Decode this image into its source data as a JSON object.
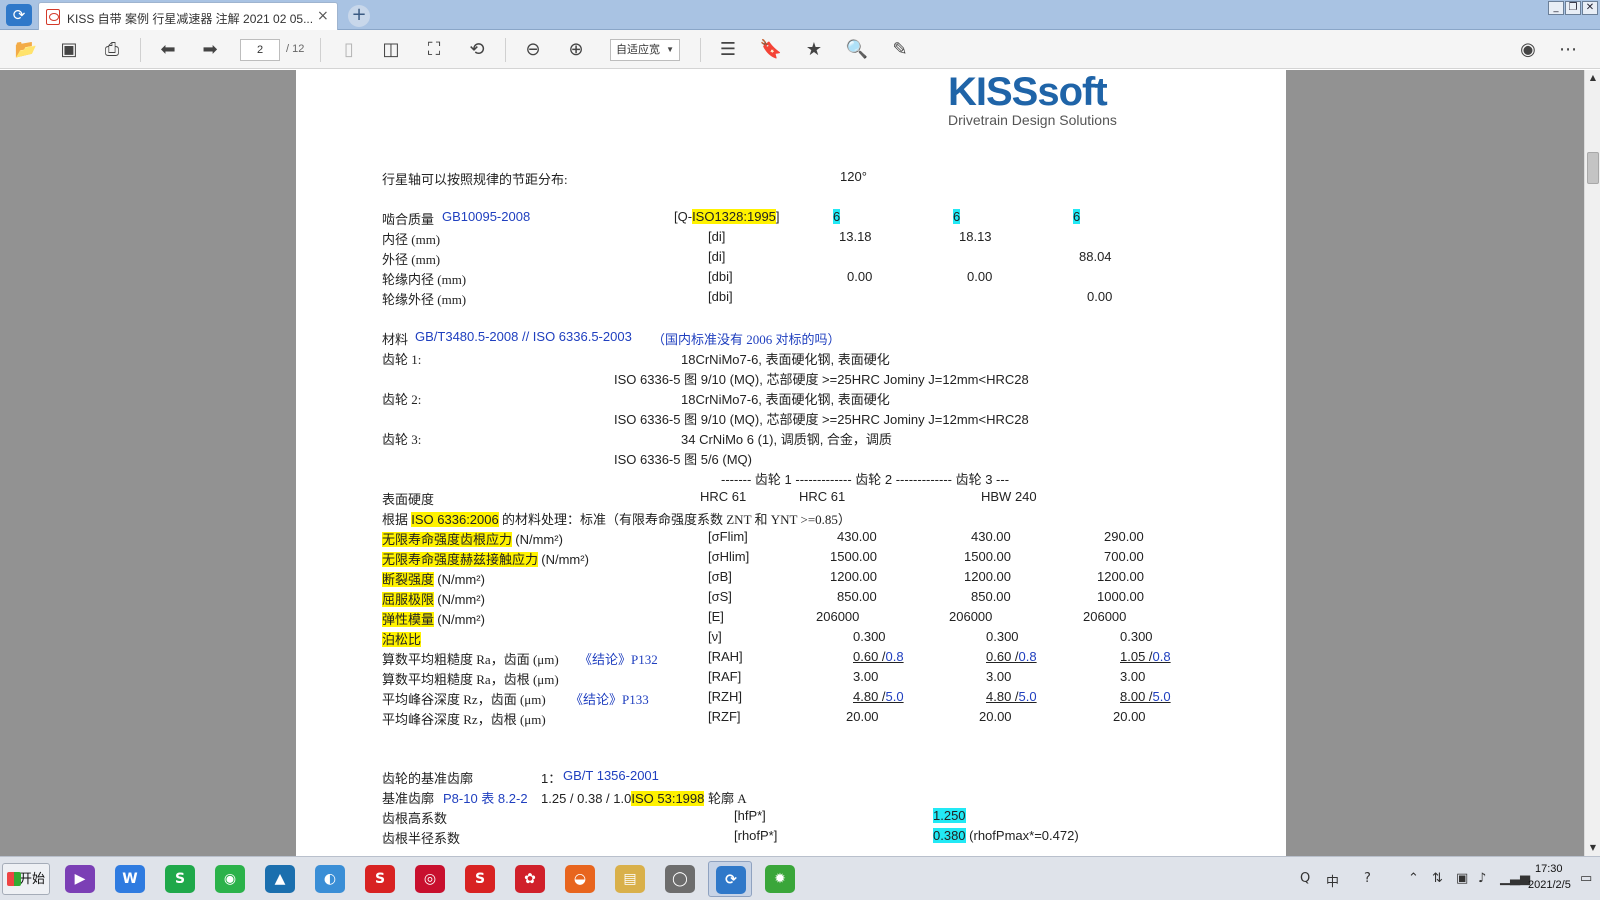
{
  "app": {
    "tab_title": "KISS 自带 案例 行星减速器 注解 2021 02 05...",
    "tab_close": "×",
    "new_tab": "+"
  },
  "window_controls": {
    "minimize": "_",
    "restore": "❐",
    "close": "✕"
  },
  "toolbar": {
    "page_current": "2",
    "page_total": "/ 12",
    "zoom_value": "自适应宽",
    "icons": [
      "folder-open-icon",
      "save-icon",
      "print-icon",
      "arrow-left-icon",
      "arrow-right-icon",
      "single-page-icon",
      "two-page-icon",
      "fit-page-icon",
      "rotate-icon",
      "zoom-out-icon",
      "zoom-in-icon",
      "outline-list-icon",
      "bookmark-add-icon",
      "star-icon",
      "search-icon",
      "sign-icon",
      "account-icon",
      "more-icon"
    ]
  },
  "logo": {
    "name": "KISSsoft",
    "tagline": "Drivetrain Design Solutions"
  },
  "document": {
    "planet_pitch": {
      "label": "行星轴可以按照规律的节距分布:",
      "value": "120°"
    },
    "quality": {
      "label": "啮合质量",
      "std": "GB10095-2008",
      "sym_prefix": "[Q-",
      "sym_hl": "ISO1328:1995",
      "sym_suffix": "]",
      "v1": "6",
      "v2": "6",
      "v3": "6"
    },
    "dims": [
      {
        "label": "内径 (mm)",
        "sym": "[di]",
        "v1": "13.18",
        "v2": "18.13",
        "v3": ""
      },
      {
        "label": "外径 (mm)",
        "sym": "[di]",
        "v1": "",
        "v2": "",
        "v3": "88.04"
      },
      {
        "label": "轮缘内径 (mm)",
        "sym": "[dbi]",
        "v1": "0.00",
        "v2": "0.00",
        "v3": ""
      },
      {
        "label": "轮缘外径 (mm)",
        "sym": "[dbi]",
        "v1": "",
        "v2": "",
        "v3": "0.00"
      }
    ],
    "material": {
      "label": "材料",
      "std": "GB/T3480.5-2008  // ISO 6336.5-2003",
      "note": "（国内标准没有 2006 对标的吗）",
      "gear1_label": "齿轮 1:",
      "gear1_mat": "18CrNiMo7-6, 表面硬化钢, 表面硬化",
      "gear1_ref": "ISO 6336-5 图 9/10 (MQ), 芯部硬度 >=25HRC Jominy J=12mm<HRC28",
      "gear2_label": "齿轮 2:",
      "gear2_mat": "18CrNiMo7-6, 表面硬化钢, 表面硬化",
      "gear2_ref": "ISO 6336-5 图 9/10 (MQ), 芯部硬度 >=25HRC Jominy J=12mm<HRC28",
      "gear3_label": "齿轮 3:",
      "gear3_mat": "34 CrNiMo 6 (1), 调质钢, 合金，调质",
      "gear3_ref": "ISO 6336-5 图 5/6 (MQ)",
      "col_header": "------- 齿轮 1 ------------- 齿轮 2 ------------- 齿轮 3 ---"
    },
    "hardness": {
      "label": "表面硬度",
      "v1": "HRC 61",
      "v2": "HRC 61",
      "v3": "HBW 240"
    },
    "treatment": {
      "prefix": "根据",
      "std": "ISO 6336:2006",
      "text": "的材料处理：标准（有限寿命强度系数 ZNT 和 YNT >=0.85）"
    },
    "props": [
      {
        "label": "无限寿命强度齿根应力",
        "unit": "(N/mm²)",
        "sym": "[σFlim]",
        "v1": "430.00",
        "v2": "430.00",
        "v3": "290.00"
      },
      {
        "label": "无限寿命强度赫兹接触应力",
        "unit": "(N/mm²)",
        "sym": "[σHlim]",
        "v1": "1500.00",
        "v2": "1500.00",
        "v3": "700.00"
      },
      {
        "label": "断裂强度",
        "unit": "(N/mm²)",
        "sym": "[σB]",
        "v1": "1200.00",
        "v2": "1200.00",
        "v3": "1200.00"
      },
      {
        "label": "屈服极限",
        "unit": "(N/mm²)",
        "sym": "[σS]",
        "v1": "850.00",
        "v2": "850.00",
        "v3": "1000.00"
      },
      {
        "label": "弹性模量",
        "unit": "(N/mm²)",
        "sym": "[E]",
        "v1": "206000",
        "v2": "206000",
        "v3": "206000"
      },
      {
        "label": "泊松比",
        "unit": "",
        "sym": "[ν]",
        "v1": "0.300",
        "v2": "0.300",
        "v3": "0.300"
      }
    ],
    "rough": [
      {
        "label": "算数平均粗糙度 Ra，齿面 (μm)",
        "ref": "《结论》P132",
        "sym": "[RAH]",
        "v1a": "0.60 /",
        "v1b": "0.8",
        "v2a": "0.60 /",
        "v2b": "0.8",
        "v3a": "1.05 /",
        "v3b": "0.8"
      },
      {
        "label": "算数平均粗糙度 Ra，齿根 (μm)",
        "ref": "",
        "sym": "[RAF]",
        "v1a": "3.00",
        "v1b": "",
        "v2a": "3.00",
        "v2b": "",
        "v3a": "3.00",
        "v3b": ""
      },
      {
        "label": "平均峰谷深度 Rz，齿面 (μm)",
        "ref": "《结论》P133",
        "sym": "[RZH]",
        "v1a": "4.80 /",
        "v1b": "5.0",
        "v2a": "4.80 /",
        "v2b": "5.0",
        "v3a": "8.00 /",
        "v3b": "5.0"
      },
      {
        "label": "平均峰谷深度 Rz，齿根 (μm)",
        "ref": "",
        "sym": "[RZF]",
        "v1a": "20.00",
        "v1b": "",
        "v2a": "20.00",
        "v2b": "",
        "v3a": "20.00",
        "v3b": ""
      }
    ],
    "basic_rack": {
      "label": "齿轮的基准齿廓",
      "idx": "1：",
      "std": "GB/T 1356-2001",
      "profile_label": "基准齿廓",
      "profile_ref": "P8-10 表 8.2-2",
      "profile_val": "1.25 / 0.38 / 1.0",
      "profile_std": "ISO 53:1998",
      "profile_suffix": "轮廓 A",
      "hfp_label": "齿根高系数",
      "hfp_sym": "[hfP*]",
      "hfp_val": "1.250",
      "rho_label": "齿根半径系数",
      "rho_sym": "[rhofP*]",
      "rho_val": "0.380",
      "rho_note": "(rhofPmax*=0.472)"
    }
  },
  "taskbar": {
    "start": "开始",
    "apps": [
      {
        "name": "visual-studio-icon",
        "color": "#7b3fb5",
        "glyph": "▶"
      },
      {
        "name": "wps-writer-icon",
        "color": "#2f7be0",
        "glyph": "W"
      },
      {
        "name": "wps-sheet-icon",
        "color": "#1fa84a",
        "glyph": "S"
      },
      {
        "name": "wechat-icon",
        "color": "#2bb24a",
        "glyph": "◉"
      },
      {
        "name": "autodesk-icon",
        "color": "#1b6fae",
        "glyph": "▲"
      },
      {
        "name": "browser-icon",
        "color": "#3a8ed6",
        "glyph": "◐"
      },
      {
        "name": "solidworks-icon",
        "color": "#d82222",
        "glyph": "S"
      },
      {
        "name": "cnc-icon",
        "color": "#c8102e",
        "glyph": "◎"
      },
      {
        "name": "solidworks2-icon",
        "color": "#d82222",
        "glyph": "S"
      },
      {
        "name": "huawei-icon",
        "color": "#d0202a",
        "glyph": "✿"
      },
      {
        "name": "app-orange-icon",
        "color": "#e8651e",
        "glyph": "◒"
      },
      {
        "name": "file-explorer-icon",
        "color": "#d9b04a",
        "glyph": "▤"
      },
      {
        "name": "simol-icon",
        "color": "#6d6d6d",
        "glyph": "◯"
      },
      {
        "name": "pdf-reader-icon",
        "color": "#2f78c9",
        "glyph": "⟳"
      },
      {
        "name": "kisssoft-gear-icon",
        "color": "#3aa63a",
        "glyph": "✹"
      }
    ],
    "time": "17:30",
    "date": "2021/2/5"
  }
}
